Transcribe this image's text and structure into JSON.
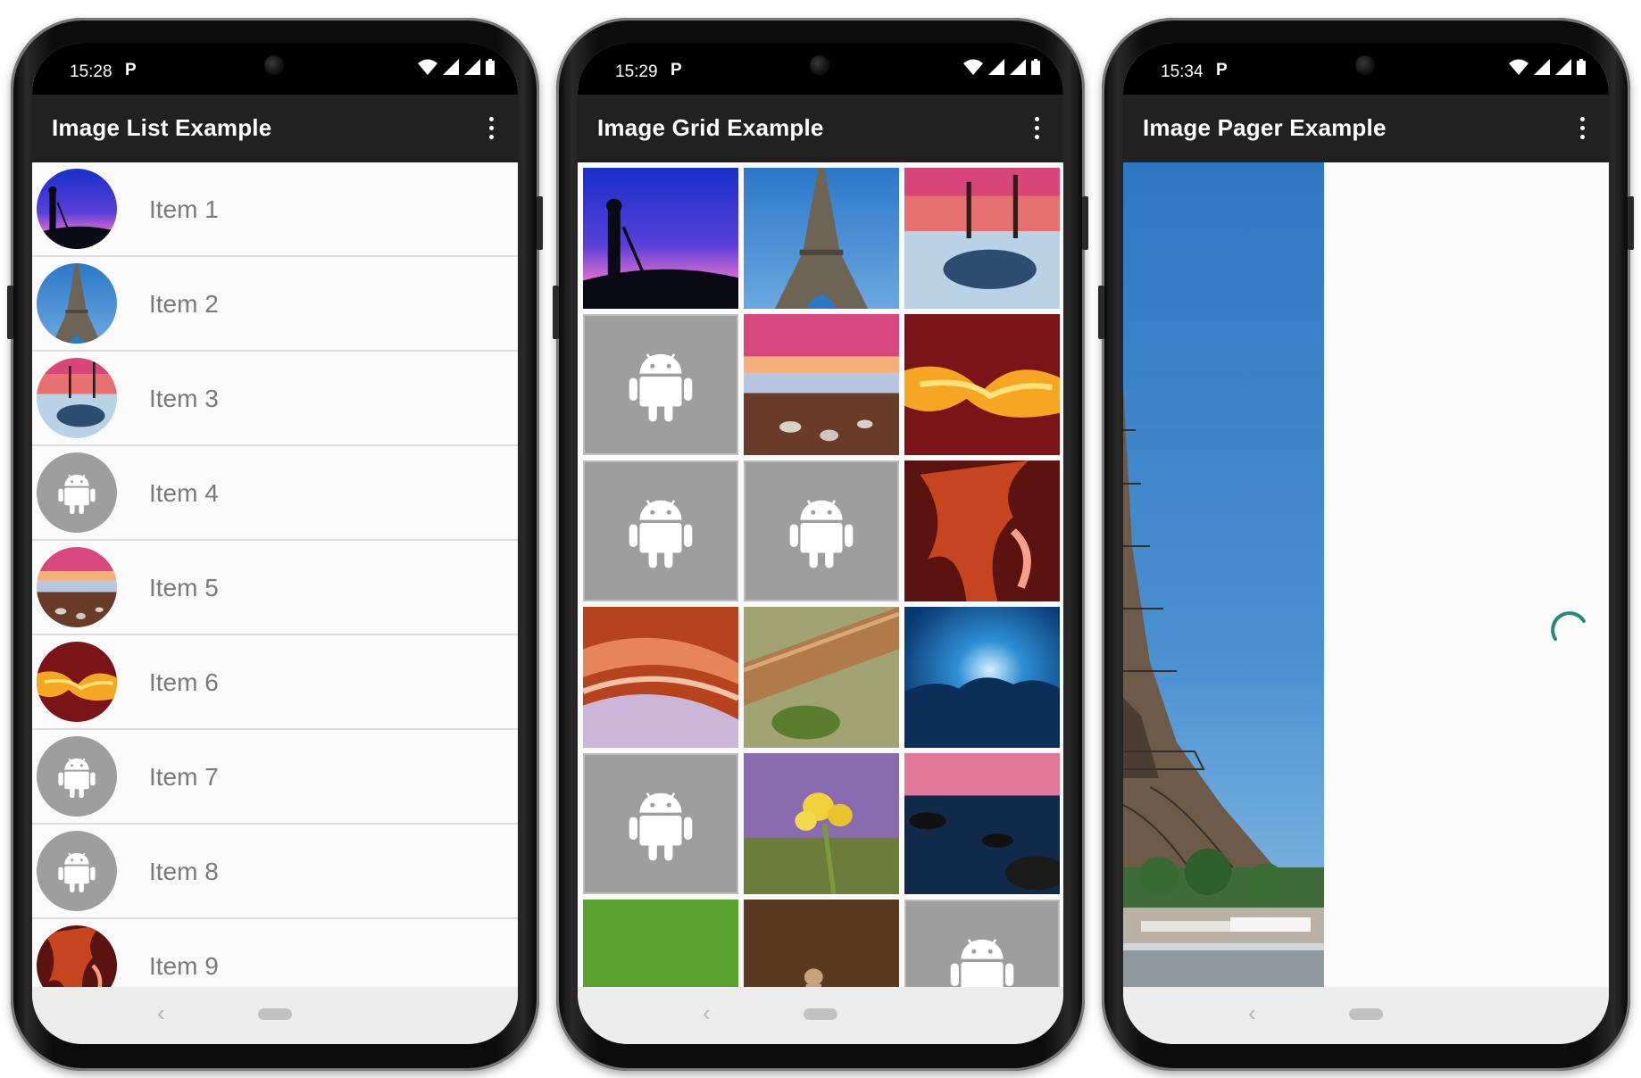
{
  "colors": {
    "appbar": "#212121",
    "accent": "#26897a",
    "placeholder": "#9e9e9e",
    "list_text": "#7a7a7a"
  },
  "phones": [
    {
      "time": "15:28",
      "title": "Image List Example"
    },
    {
      "time": "15:29",
      "title": "Image Grid Example"
    },
    {
      "time": "15:34",
      "title": "Image Pager Example"
    }
  ],
  "status": {
    "p_mark": "P"
  },
  "nav": {
    "back_glyph": "‹"
  },
  "list_items": [
    {
      "label": "Item 1",
      "image": "photographer-silhouette"
    },
    {
      "label": "Item 2",
      "image": "eiffel-tower"
    },
    {
      "label": "Item 3",
      "image": "snowy-lake"
    },
    {
      "label": "Item 4",
      "image": "android-placeholder"
    },
    {
      "label": "Item 5",
      "image": "beach-sunset"
    },
    {
      "label": "Item 6",
      "image": "canyon-glow"
    },
    {
      "label": "Item 7",
      "image": "android-placeholder"
    },
    {
      "label": "Item 8",
      "image": "android-placeholder"
    },
    {
      "label": "Item 9",
      "image": "red-canyon"
    }
  ],
  "grid_cells": [
    "photographer-silhouette",
    "eiffel-tower",
    "snowy-lake",
    "android-placeholder",
    "beach-sunset",
    "canyon-glow",
    "android-placeholder",
    "android-placeholder",
    "red-canyon",
    "sandstone-waves",
    "rope-closeup",
    "blue-cloud",
    "android-placeholder",
    "yellow-flower",
    "rocky-lake",
    "green-caterpillar",
    "chess-pieces",
    "android-placeholder"
  ],
  "pager": {
    "image": "eiffel-tower-large",
    "loading": true
  }
}
